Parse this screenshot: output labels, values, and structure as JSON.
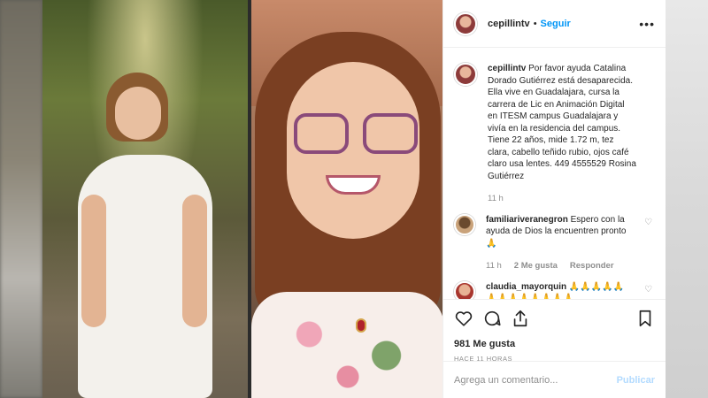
{
  "post": {
    "username": "cepillintv",
    "follow_label": "Seguir",
    "caption_user": "cepillintv",
    "caption": "Por favor ayuda Catalina Dorado Gutiérrez está desaparecida. Ella vive en Guadalajara, cursa la carrera de Lic en Animación Digital en ITESM campus Guadalajara y vivía en la residencia del campus. Tiene 22 años, mide 1.72 m, tez clara, cabello teñido rubio, ojos café claro usa lentes. 449 4555529 Rosina Gutiérrez",
    "caption_time": "11 h",
    "likes": "981 Me gusta",
    "posted": "HACE 11 HORAS"
  },
  "comments": [
    {
      "user": "familiariveranegron",
      "text": "Espero con la ayuda de Dios la encuentren pronto🙏",
      "time": "11 h",
      "likes": "2 Me gusta",
      "reply_label": "Responder"
    },
    {
      "user": "claudia_mayorquin",
      "text": "🙏🙏🙏🙏🙏🙏🙏🙏🙏🙏🙏🙏🙏"
    }
  ],
  "add_comment": {
    "placeholder": "Agrega un comentario...",
    "publish_label": "Publicar"
  },
  "colors": {
    "link": "#0095f6",
    "publish_disabled": "#b3dbff",
    "muted": "#8e8e8e"
  },
  "icons": [
    "more-icon",
    "heart-icon",
    "comment-icon",
    "share-icon",
    "bookmark-icon"
  ]
}
